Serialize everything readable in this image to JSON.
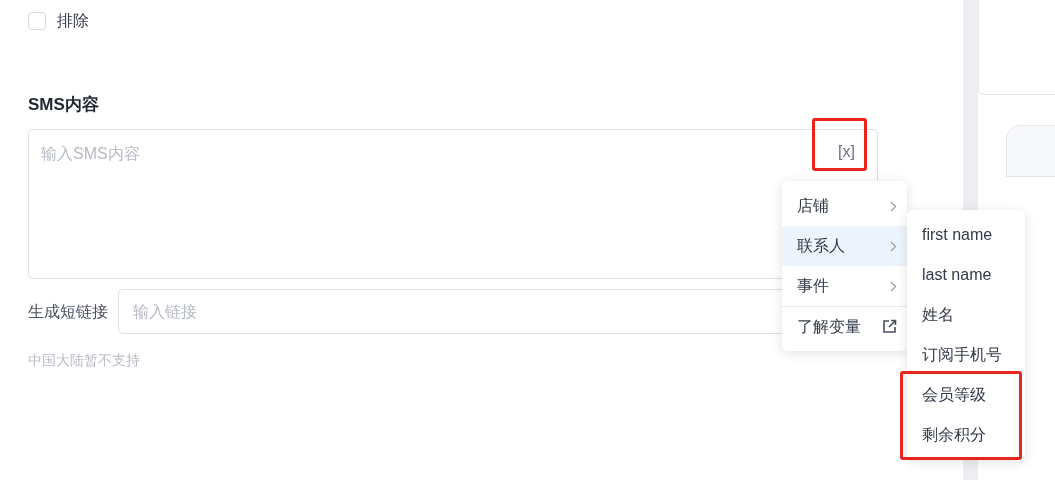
{
  "exclude": {
    "label": "排除",
    "checked": false
  },
  "sms": {
    "heading": "SMS内容",
    "placeholder": "输入SMS内容",
    "variable_button": "[x]"
  },
  "short_link": {
    "label": "生成短链接",
    "placeholder": "输入链接"
  },
  "hint": "中国大陆暂不支持",
  "variable_menu": {
    "items": [
      {
        "label": "店铺",
        "kind": "submenu",
        "selected": false
      },
      {
        "label": "联系人",
        "kind": "submenu",
        "selected": true
      },
      {
        "label": "事件",
        "kind": "submenu",
        "selected": false
      },
      {
        "label": "了解变量",
        "kind": "link",
        "selected": false
      }
    ]
  },
  "contact_submenu": {
    "items": [
      {
        "label": "first name"
      },
      {
        "label": "last name"
      },
      {
        "label": "姓名"
      },
      {
        "label": "订阅手机号"
      },
      {
        "label": "会员等级"
      },
      {
        "label": "剩余积分"
      }
    ]
  }
}
